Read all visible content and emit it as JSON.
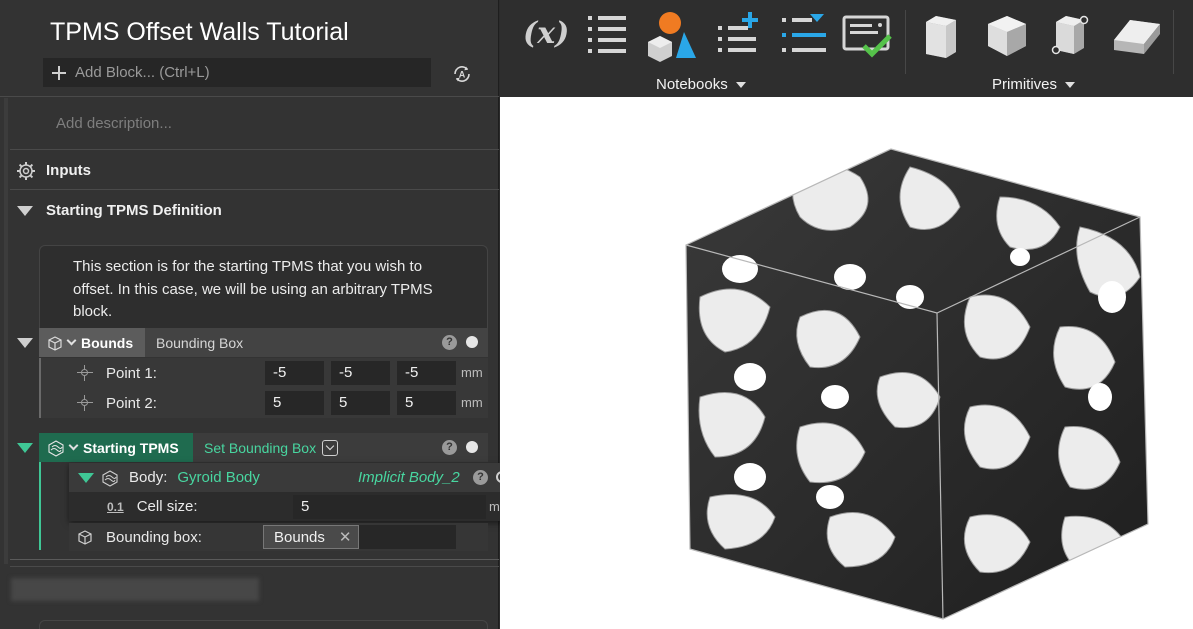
{
  "app": {
    "title": "TPMS Offset Walls Tutorial",
    "add_block_placeholder": "Add Block... (Ctrl+L)",
    "description_placeholder": "Add description..."
  },
  "sections": {
    "inputs_label": "Inputs",
    "starting_label": "Starting TPMS Definition",
    "note": "This section is for the starting TPMS that you wish to offset. In this case, we will be using an arbitrary TPMS block."
  },
  "bounds_block": {
    "tag": "Bounds",
    "type": "Bounding Box",
    "help": "?",
    "point1": {
      "label": "Point 1:",
      "x": "-5",
      "y": "-5",
      "z": "-5",
      "unit": "mm"
    },
    "point2": {
      "label": "Point 2:",
      "x": "5",
      "y": "5",
      "z": "5",
      "unit": "mm"
    }
  },
  "tpms_block": {
    "tag": "Starting TPMS",
    "type": "Set Bounding Box",
    "help": "?",
    "body": {
      "label": "Body:",
      "value": "Gyroid Body",
      "output": "Implicit Body_2",
      "help": "?",
      "cell_size_icon_text": "0.1",
      "cell_size_label": "Cell size:",
      "cell_size_value": "5",
      "cell_size_unit": "mm"
    },
    "bounding_box": {
      "label": "Bounding box:",
      "chip": "Bounds",
      "chip_remove": "✕"
    }
  },
  "toolbar": {
    "variable_icon_text": "(x)",
    "groups": [
      {
        "label": "Notebooks"
      },
      {
        "label": "Primitives"
      }
    ]
  },
  "colors": {
    "accent_green": "#3fc795",
    "tpms_tag_bg": "#1f6b4f",
    "toolbar_blue": "#2aa7e8",
    "toolbar_orange": "#f07b22",
    "check_green": "#55c24a"
  },
  "viewport": {
    "object": "gyroid-cube",
    "background": "#ffffff"
  }
}
